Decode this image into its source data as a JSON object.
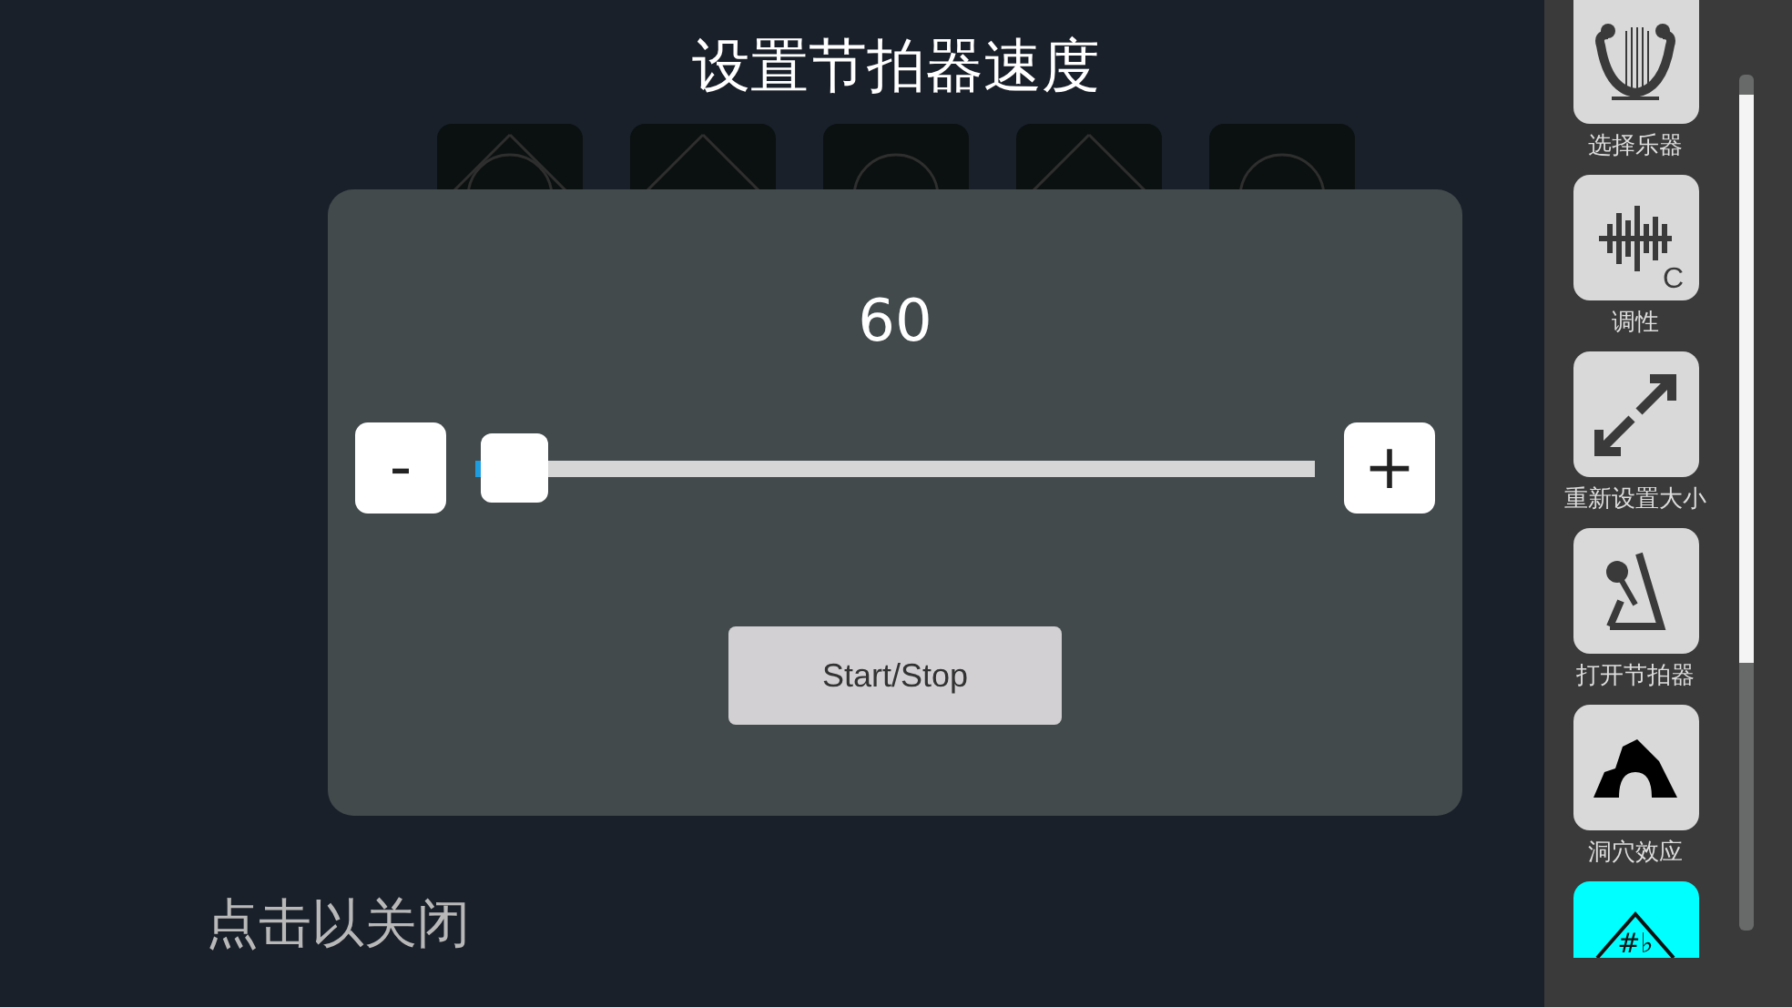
{
  "title": "设置节拍器速度",
  "background_tiles": [
    {
      "kind": "triangle-circle"
    },
    {
      "kind": "triangle"
    },
    {
      "kind": "circle"
    },
    {
      "kind": "triangle"
    },
    {
      "kind": "circle"
    }
  ],
  "tempo_dialog": {
    "value": "60",
    "minus": "-",
    "plus": "+",
    "level": 0.01,
    "start_stop": "Start/Stop"
  },
  "close_hint": "点击以关闭",
  "sidebar": {
    "items": [
      {
        "kind": "lyre",
        "label": "选择乐器",
        "highlighted": false
      },
      {
        "kind": "key",
        "label": "调性",
        "icon_text": "C",
        "highlighted": false
      },
      {
        "kind": "resize",
        "label": "重新设置大小",
        "highlighted": false
      },
      {
        "kind": "metronome",
        "label": "打开节拍器",
        "highlighted": false
      },
      {
        "kind": "cave",
        "label": "洞穴效应",
        "highlighted": false
      },
      {
        "kind": "accidental",
        "icon_text": "#♭",
        "highlighted": true
      }
    ]
  }
}
